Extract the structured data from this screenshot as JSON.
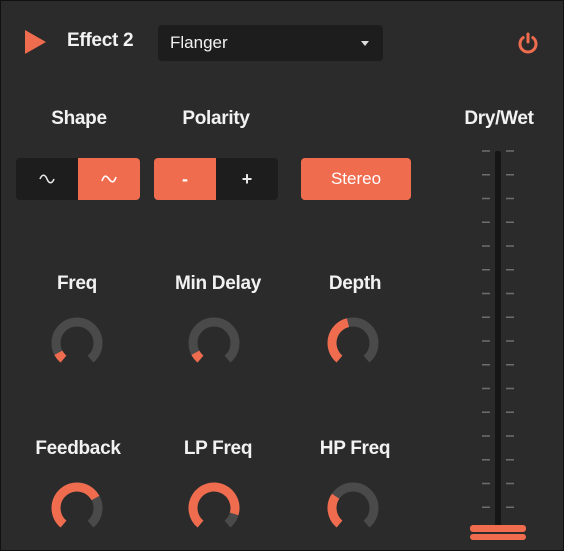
{
  "header": {
    "play_icon": "play-icon",
    "title": "Effect 2",
    "effect_type": "Flanger",
    "power_icon": "power-icon",
    "power_color": "#ef6c4f"
  },
  "shape": {
    "label": "Shape",
    "options": [
      "sine-wave-icon",
      "triangle-wave-icon"
    ],
    "selected": 1
  },
  "polarity": {
    "label": "Polarity",
    "options": [
      "-",
      "+"
    ],
    "selected": 0
  },
  "stereo": {
    "label": "Stereo",
    "active": true
  },
  "drywet": {
    "label": "Dry/Wet",
    "value": 0.0
  },
  "knobs": [
    {
      "label": "Freq",
      "value": 0.08
    },
    {
      "label": "Min Delay",
      "value": 0.08
    },
    {
      "label": "Depth",
      "value": 0.45
    },
    {
      "label": "Feedback",
      "value": 0.72
    },
    {
      "label": "LP Freq",
      "value": 0.88
    },
    {
      "label": "HP Freq",
      "value": 0.3
    }
  ],
  "colors": {
    "accent": "#ef6c4f",
    "panel": "#2b2b2b",
    "control_bg": "#1d1d1d",
    "knob_track": "#4a4a4a"
  }
}
